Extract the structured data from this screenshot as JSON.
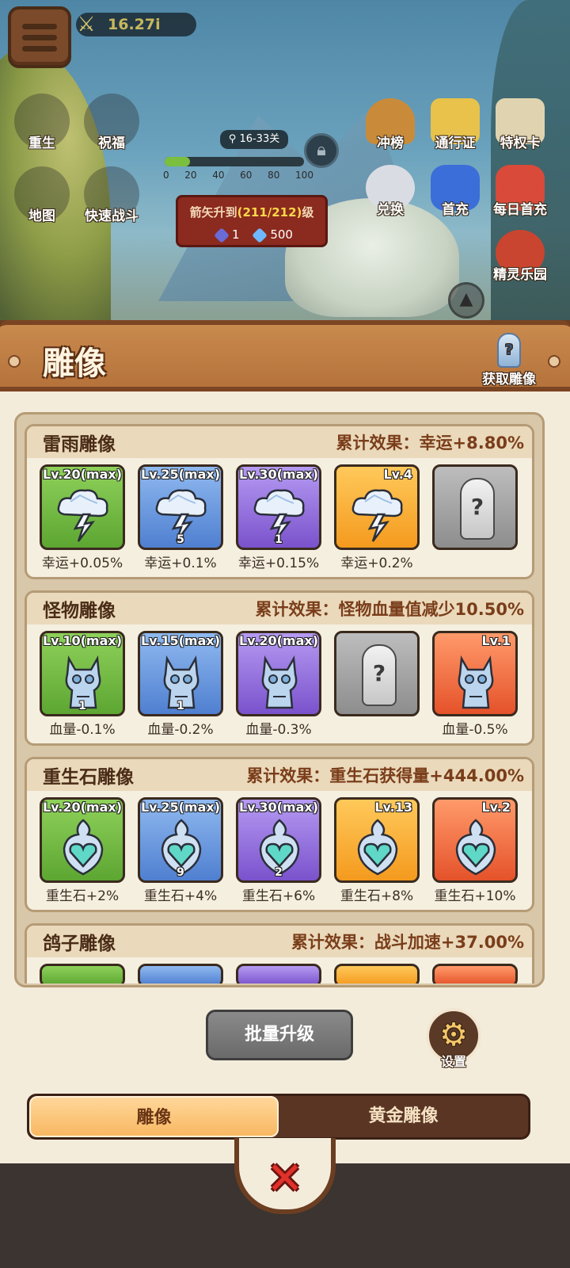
{
  "hud": {
    "power": "16.27i",
    "stage": "16-33关",
    "progress_ticks": [
      "0",
      "20",
      "40",
      "60",
      "80",
      "100"
    ],
    "progress_fraction": 0.18,
    "upgrade": {
      "prefix": "箭矢升到",
      "highlight": "(211/212)",
      "suffix": "级",
      "cost_a": "1",
      "cost_b": "500"
    }
  },
  "left_icons": [
    {
      "label": "重生"
    },
    {
      "label": "祝福"
    },
    {
      "label": "地图"
    },
    {
      "label": "快速战斗"
    }
  ],
  "right_icons": [
    {
      "label": "冲榜"
    },
    {
      "label": "通行证"
    },
    {
      "label": "特权卡"
    },
    {
      "label": "兑换"
    },
    {
      "label": "首充"
    },
    {
      "label": "每日首充"
    },
    {
      "label": "精灵乐园"
    }
  ],
  "panel": {
    "title": "雕像",
    "obtain_label": "获取雕像"
  },
  "sections": [
    {
      "name": "雷雨雕像",
      "effect": "累计效果：幸运+8.80%",
      "art": "cloud-lightning",
      "cards": [
        {
          "tier": "green",
          "level": "Lv.20(max)",
          "count": "",
          "bonus": "幸运+0.05%"
        },
        {
          "tier": "blue",
          "level": "Lv.25(max)",
          "count": "5",
          "bonus": "幸运+0.1%"
        },
        {
          "tier": "purple",
          "level": "Lv.30(max)",
          "count": "1",
          "bonus": "幸运+0.15%"
        },
        {
          "tier": "orange",
          "level": "Lv.4",
          "count": "",
          "bonus": "幸运+0.2%"
        },
        {
          "tier": "locked",
          "level": "",
          "count": "",
          "bonus": ""
        }
      ]
    },
    {
      "name": "怪物雕像",
      "effect": "累计效果：怪物血量值减少10.50%",
      "art": "monster",
      "cards": [
        {
          "tier": "green",
          "level": "Lv.10(max)",
          "count": "1",
          "bonus": "血量-0.1%"
        },
        {
          "tier": "blue",
          "level": "Lv.15(max)",
          "count": "1",
          "bonus": "血量-0.2%"
        },
        {
          "tier": "purple",
          "level": "Lv.20(max)",
          "count": "",
          "bonus": "血量-0.3%"
        },
        {
          "tier": "locked",
          "level": "",
          "count": "",
          "bonus": ""
        },
        {
          "tier": "red",
          "level": "Lv.1",
          "count": "",
          "bonus": "血量-0.5%"
        }
      ]
    },
    {
      "name": "重生石雕像",
      "effect": "累计效果：重生石获得量+444.00%",
      "art": "heart-crystal",
      "cards": [
        {
          "tier": "green",
          "level": "Lv.20(max)",
          "count": "",
          "bonus": "重生石+2%"
        },
        {
          "tier": "blue",
          "level": "Lv.25(max)",
          "count": "9",
          "bonus": "重生石+4%"
        },
        {
          "tier": "purple",
          "level": "Lv.30(max)",
          "count": "2",
          "bonus": "重生石+6%"
        },
        {
          "tier": "orange",
          "level": "Lv.13",
          "count": "",
          "bonus": "重生石+8%"
        },
        {
          "tier": "red",
          "level": "Lv.2",
          "count": "",
          "bonus": "重生石+10%"
        }
      ]
    },
    {
      "name": "鸽子雕像",
      "effect": "累计效果：战斗加速+37.00%"
    }
  ],
  "buttons": {
    "batch_upgrade": "批量升级",
    "settings": "设置"
  },
  "tabs": [
    {
      "label": "雕像",
      "active": true
    },
    {
      "label": "黄金雕像",
      "active": false
    }
  ],
  "colors": {
    "panel_bg": "#f4ecdb",
    "header_wood": "#b5733b",
    "tab_active": "#f8b862",
    "tab_bar": "#5a3524",
    "close_red": "#e0312a"
  }
}
